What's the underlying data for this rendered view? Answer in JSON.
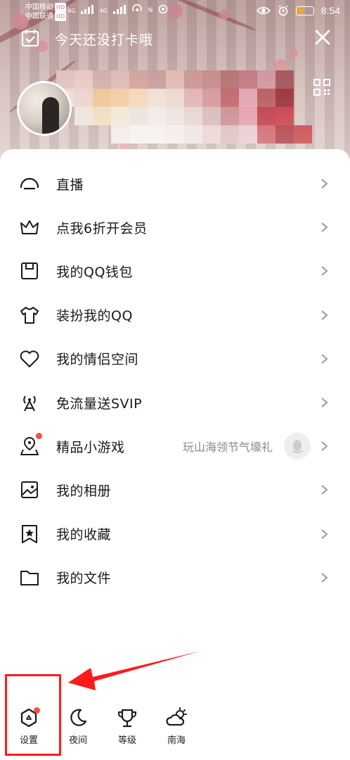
{
  "status_bar": {
    "carrier1": "中国移动",
    "carrier2": "中国联通",
    "hd": "HD",
    "net": "4G",
    "nfc": "N",
    "time": "8:54"
  },
  "header": {
    "checkin_text": "今天还没打卡哦"
  },
  "menu": {
    "items": [
      {
        "label": "直播"
      },
      {
        "label": "点我6折开会员"
      },
      {
        "label": "我的QQ钱包"
      },
      {
        "label": "装扮我的QQ"
      },
      {
        "label": "我的情侣空间"
      },
      {
        "label": "免流量送SVIP"
      },
      {
        "label": "精品小游戏",
        "extra": "玩山海领节气壕礼"
      },
      {
        "label": "我的相册"
      },
      {
        "label": "我的收藏"
      },
      {
        "label": "我的文件"
      }
    ]
  },
  "bottom_bar": {
    "settings": "设置",
    "night": "夜间",
    "level": "等级",
    "weather": "南海"
  },
  "colors": {
    "accent_red": "#f74c45",
    "annotation_red": "#ff1a1a"
  }
}
